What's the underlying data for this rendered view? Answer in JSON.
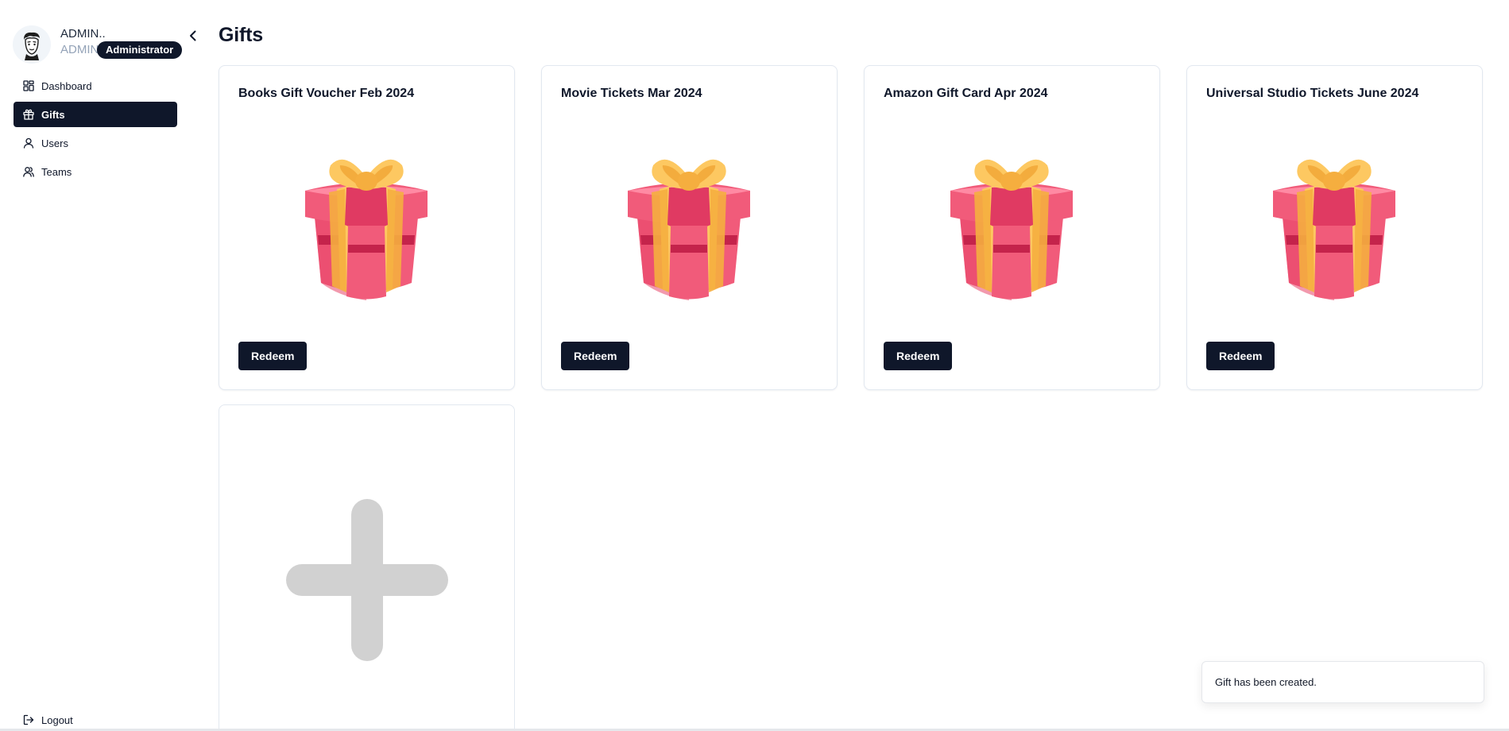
{
  "page": {
    "title": "Gifts"
  },
  "sidebar": {
    "user": {
      "name": "ADMIN..",
      "role": "ADMIN",
      "role_badge": "Administrator"
    },
    "items": [
      {
        "label": "Dashboard",
        "icon": "dashboard-icon",
        "active": false
      },
      {
        "label": "Gifts",
        "icon": "gift-icon",
        "active": true
      },
      {
        "label": "Users",
        "icon": "user-icon",
        "active": false
      },
      {
        "label": "Teams",
        "icon": "users-icon",
        "active": false
      }
    ],
    "logout_label": "Logout"
  },
  "gifts": [
    {
      "title": "Books Gift Voucher Feb 2024",
      "button": "Redeem"
    },
    {
      "title": "Movie Tickets Mar 2024",
      "button": "Redeem"
    },
    {
      "title": "Amazon Gift Card Apr 2024",
      "button": "Redeem"
    },
    {
      "title": "Universal Studio Tickets June 2024",
      "button": "Redeem"
    }
  ],
  "toast": {
    "message": "Gift has been created."
  },
  "colors": {
    "primary": "#0f172a",
    "gift_box": "#f15b7a",
    "gift_ribbon": "#fdc861"
  }
}
